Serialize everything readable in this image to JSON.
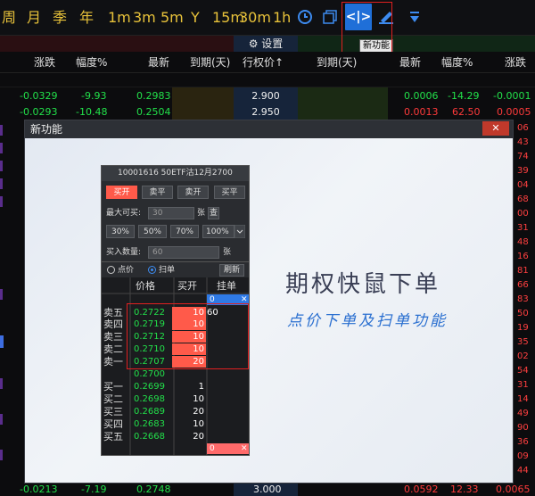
{
  "toolbar": {
    "periods": [
      "周",
      "月",
      "季",
      "年",
      "1m",
      "3m",
      "5m",
      "Y",
      "15m",
      "30m",
      "1h"
    ],
    "new_feature_icon": "<|>",
    "tooltip": "新功能"
  },
  "settings_label": "⚙ 设置",
  "header": {
    "left_cols": [
      "涨跌",
      "幅度%",
      "最新",
      "到期(天)"
    ],
    "strike": "行权价↑",
    "right_cols": [
      "到期(天)",
      "最新",
      "幅度%",
      "涨跌"
    ]
  },
  "rows": [
    {
      "l_change": "-0.0329",
      "l_pct": "-9.93",
      "l_last": "0.2983",
      "strike": "2.900",
      "r_last": "0.0006",
      "r_pct": "-14.29",
      "r_change": "-0.0001"
    },
    {
      "l_change": "-0.0293",
      "l_pct": "-10.48",
      "l_last": "0.2504",
      "strike": "2.950",
      "r_last": "0.0013",
      "r_pct": "62.50",
      "r_change": "0.0005"
    },
    {
      "l_change": "-0.0213",
      "l_pct": "-7.19",
      "l_last": "0.2748",
      "strike": "3.000",
      "r_last": "0.0592",
      "r_pct": "12.33",
      "r_change": "0.0065"
    }
  ],
  "side_numbers": [
    "06",
    "43",
    "74",
    "39",
    "04",
    "68",
    "00",
    "31",
    "48",
    "16",
    "81",
    "66",
    "83",
    "50",
    "19",
    "35",
    "02",
    "54",
    "31",
    "14",
    "49",
    "90",
    "36",
    "09",
    "44"
  ],
  "dialog": {
    "title": "新功能",
    "close": "✕",
    "promo_title": "期权快鼠下单",
    "promo_subtitle": "点价下单及扫单功能"
  },
  "panel": {
    "contract": "10001616  50ETF沽12月2700",
    "actions": [
      "买开",
      "卖平",
      "卖开",
      "买平"
    ],
    "max_buy_label": "最大可买:",
    "max_buy_value": "30",
    "unit": "张",
    "query": "查",
    "ratios": [
      "30%",
      "50%",
      "70%",
      "100%"
    ],
    "buy_qty_label": "买入数量:",
    "buy_qty_value": "60",
    "mode_point": "点价",
    "mode_scan": "扫单",
    "refresh": "刷新",
    "col_price": "价格",
    "col_buyopen": "买开",
    "col_pending": "挂单",
    "top_pending": "0",
    "bottom_pending": "0",
    "close_x": "✕",
    "asks": [
      {
        "label": "卖五",
        "price": "0.2722",
        "qty": "10",
        "pending": "60"
      },
      {
        "label": "卖四",
        "price": "0.2719",
        "qty": "10",
        "pending": ""
      },
      {
        "label": "卖三",
        "price": "0.2712",
        "qty": "10",
        "pending": ""
      },
      {
        "label": "卖二",
        "price": "0.2710",
        "qty": "10",
        "pending": ""
      },
      {
        "label": "卖一",
        "price": "0.2707",
        "qty": "20",
        "pending": ""
      }
    ],
    "mid_price": "0.2700",
    "bids": [
      {
        "label": "买一",
        "price": "0.2699",
        "qty": "1"
      },
      {
        "label": "买二",
        "price": "0.2698",
        "qty": "10"
      },
      {
        "label": "买三",
        "price": "0.2689",
        "qty": "20"
      },
      {
        "label": "买四",
        "price": "0.2683",
        "qty": "10"
      },
      {
        "label": "买五",
        "price": "0.2668",
        "qty": "20"
      }
    ]
  }
}
